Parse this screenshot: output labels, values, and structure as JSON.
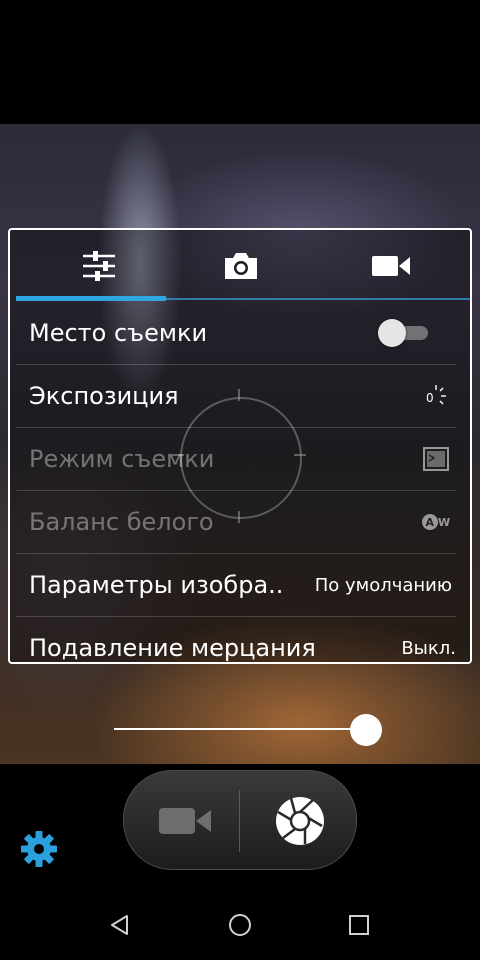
{
  "tabs": [
    {
      "id": "settings",
      "icon": "sliders-icon",
      "selected": true
    },
    {
      "id": "photo",
      "icon": "camera-icon",
      "selected": false
    },
    {
      "id": "video",
      "icon": "video-camera-icon",
      "selected": false
    }
  ],
  "settings": {
    "location": {
      "label": "Место съемки",
      "toggle_on": false
    },
    "exposure": {
      "label": "Экспозиция",
      "icon": "exposure-icon",
      "icon_text": "0"
    },
    "scene_mode": {
      "label": "Режим съемки",
      "icon": "scene-mode-icon",
      "enabled": false
    },
    "white_balance": {
      "label": "Баланс белого",
      "icon": "white-balance-auto-icon",
      "icon_text": "AW",
      "enabled": false
    },
    "image_params": {
      "label": "Параметры изобра..",
      "value": "По умолчанию"
    },
    "anti_flicker": {
      "label": "Подавление мерцания",
      "value": "Выкл."
    }
  },
  "zoom_slider": {
    "level": 1.0
  },
  "controls": {
    "video_button_icon": "video-camera-icon",
    "shutter_button_icon": "aperture-icon",
    "settings_icon": "gear-icon"
  },
  "navbar": [
    "back-icon",
    "home-icon",
    "recents-icon"
  ],
  "colors": {
    "accent": "#2fa6e0",
    "gear": "#2aa0de"
  }
}
